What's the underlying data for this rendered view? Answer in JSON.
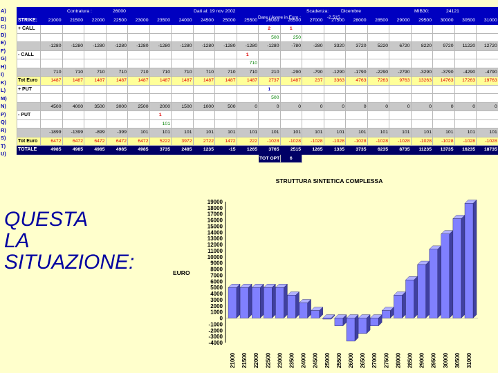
{
  "row_letters": [
    "A)",
    "B)",
    "C)",
    "D)",
    "E)",
    "F)",
    "G)",
    "H)",
    "I)",
    "K)",
    "L)",
    "M)",
    "N)",
    "P)",
    "Q)",
    "R)",
    "S)",
    "T)",
    "U)"
  ],
  "header": {
    "contratura_label": "Contratura :",
    "contratura_value": "26000",
    "dati_al_label": "Dati al: 19 nov 2002",
    "scadenza_label": "Scadenza:",
    "scadenza_value": "Dicembre",
    "mib30_label": "MIB30:",
    "mib30_value": "24121",
    "dare_avere_label": "Dare / Avere in Euro :",
    "dare_avere_value": "-2.515"
  },
  "table": {
    "strikes": [
      "21000",
      "21500",
      "22000",
      "22500",
      "23000",
      "23500",
      "24000",
      "24500",
      "25000",
      "25500",
      "26000",
      "26500",
      "27000",
      "27500",
      "28000",
      "28500",
      "29000",
      "29500",
      "30000",
      "30500",
      "31000"
    ],
    "labels": {
      "strike": "STRIKE:",
      "call_buy": "+ CALL",
      "call_sell": "- CALL",
      "put_buy": "+ PUT",
      "put_sell": "- PUT",
      "tot_euro": "Tot Euro",
      "totale": "TOTALE"
    },
    "rows": {
      "C": [
        "",
        "",
        "",
        "",
        "",
        "",
        "",
        "",
        "",
        "",
        "2",
        "1",
        "",
        "",
        "",
        "",
        "",
        "",
        "",
        "",
        ""
      ],
      "D": [
        "",
        "",
        "",
        "",
        "",
        "",
        "",
        "",
        "",
        "",
        "500",
        "250",
        "",
        "",
        "",
        "",
        "",
        "",
        "",
        "",
        ""
      ],
      "E": [
        "-1280",
        "-1280",
        "-1280",
        "-1280",
        "-1280",
        "-1280",
        "-1280",
        "-1280",
        "-1280",
        "-1280",
        "-1280",
        "-780",
        "-280",
        "3320",
        "3720",
        "5220",
        "6720",
        "8220",
        "9720",
        "11220",
        "12720"
      ],
      "F": [
        "",
        "",
        "",
        "",
        "",
        "",
        "",
        "",
        "",
        "1",
        "",
        "",
        "",
        "",
        "",
        "",
        "",
        "",
        "",
        "",
        ""
      ],
      "G": [
        "",
        "",
        "",
        "",
        "",
        "",
        "",
        "",
        "",
        "710",
        "",
        "",
        "",
        "",
        "",
        "",
        "",
        "",
        "",
        "",
        ""
      ],
      "H": [
        "710",
        "710",
        "710",
        "710",
        "710",
        "710",
        "710",
        "710",
        "710",
        "710",
        "210",
        "-290",
        "-790",
        "-1290",
        "-1790",
        "-2290",
        "-2790",
        "-3290",
        "-3790",
        "-4290",
        "-4790"
      ],
      "I": [
        "1487",
        "1487",
        "1487",
        "1487",
        "1487",
        "1487",
        "1487",
        "1487",
        "1487",
        "1487",
        "2737",
        "1487",
        "237",
        "3363",
        "4763",
        "7263",
        "9763",
        "13263",
        "14763",
        "17263",
        "19763"
      ],
      "K": [
        "",
        "",
        "",
        "",
        "",
        "",
        "",
        "",
        "",
        "",
        "1",
        "",
        "",
        "",
        "",
        "",
        "",
        "",
        "",
        "",
        ""
      ],
      "L": [
        "",
        "",
        "",
        "",
        "",
        "",
        "",
        "",
        "",
        "",
        "500",
        "",
        "",
        "",
        "",
        "",
        "",
        "",
        "",
        "",
        ""
      ],
      "M": [
        "4500",
        "4000",
        "3500",
        "3000",
        "2500",
        "2000",
        "1500",
        "1000",
        "500",
        "0",
        "0",
        "0",
        "0",
        "0",
        "0",
        "0",
        "0",
        "0",
        "0",
        "0",
        "0"
      ],
      "N": [
        "",
        "",
        "",
        "",
        "",
        "1",
        "",
        "",
        "",
        "",
        "",
        "",
        "",
        "",
        "",
        "",
        "",
        "",
        "",
        "",
        ""
      ],
      "P": [
        "",
        "",
        "",
        "",
        "",
        "101",
        "",
        "",
        "",
        "",
        "",
        "",
        "",
        "",
        "",
        "",
        "",
        "",
        "",
        "",
        ""
      ],
      "Q": [
        "-1899",
        "-1399",
        "-899",
        "-399",
        "101",
        "101",
        "101",
        "101",
        "101",
        "101",
        "101",
        "101",
        "101",
        "101",
        "101",
        "101",
        "101",
        "101",
        "101",
        "101",
        "101"
      ],
      "R": [
        "6472",
        "6472",
        "6472",
        "6472",
        "6472",
        "5222",
        "3972",
        "2722",
        "1472",
        "222",
        "-1028",
        "-1028",
        "-1028",
        "-1028",
        "-1028",
        "-1028",
        "-1028",
        "-1028",
        "-1028",
        "-1028",
        "-1028"
      ],
      "S": [
        "4985",
        "4985",
        "4985",
        "4985",
        "4985",
        "3735",
        "2485",
        "1235",
        "-15",
        "1265",
        "3765",
        "2515",
        "1265",
        "1335",
        "3735",
        "6235",
        "8735",
        "11235",
        "13735",
        "16235",
        "18735"
      ]
    },
    "tot_opt_label": "TOT OPT",
    "tot_opt_value": "6"
  },
  "big_text": [
    "QUESTA",
    "LA",
    "SITUAZIONE:"
  ],
  "chart_data": {
    "type": "bar",
    "title": "STRUTTURA SINTETICA COMPLESSA",
    "ylabel": "EURO",
    "categories": [
      "21000",
      "21500",
      "22000",
      "22500",
      "23000",
      "23500",
      "24000",
      "24500",
      "25000",
      "25500",
      "26000",
      "26500",
      "27000",
      "27500",
      "28000",
      "28500",
      "29000",
      "29500",
      "30000",
      "30500",
      "31000"
    ],
    "values": [
      4985,
      4985,
      4985,
      4985,
      4985,
      3735,
      2485,
      1235,
      -15,
      -1265,
      -3765,
      -2515,
      -1265,
      1235,
      3735,
      6235,
      8735,
      11235,
      13735,
      16235,
      18735
    ],
    "ylim": [
      -4000,
      19000
    ],
    "yticks": [
      "19000",
      "18000",
      "17000",
      "16000",
      "15000",
      "14000",
      "13000",
      "12000",
      "11000",
      "10000",
      "9000",
      "8000",
      "7000",
      "6000",
      "5000",
      "4000",
      "3000",
      "2000",
      "1000",
      "0",
      "-1000",
      "-2000",
      "-3000",
      "-4000"
    ],
    "bar_color": "#8080ff",
    "bar_top_color": "#b0b0ff",
    "bar_side_color": "#4040a0"
  }
}
